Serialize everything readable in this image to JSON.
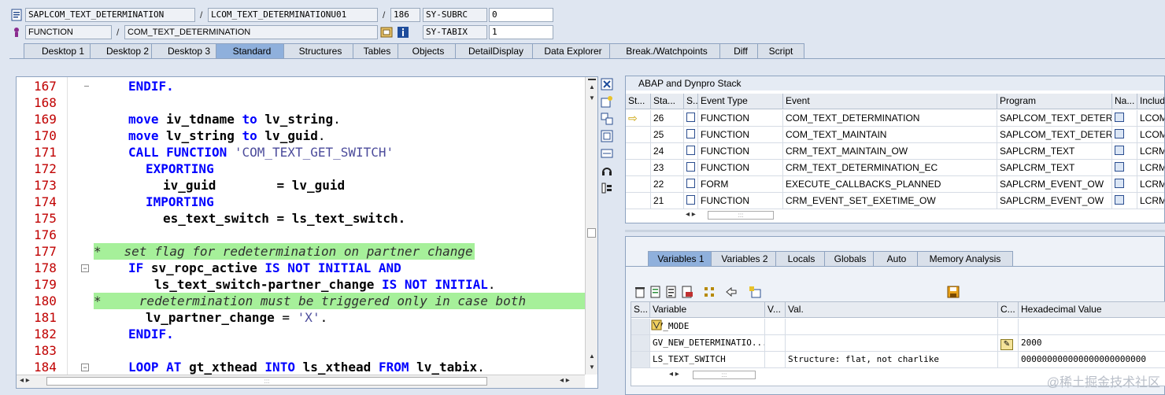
{
  "header": {
    "program": "SAPLCOM_TEXT_DETERMINATION",
    "include": "LCOM_TEXT_DETERMINATIONU01",
    "line": "186",
    "var1_name": "SY-SUBRC",
    "var1_value": "0",
    "type": "FUNCTION",
    "name": "COM_TEXT_DETERMINATION",
    "var2_name": "SY-TABIX",
    "var2_value": "1"
  },
  "tabs": [
    {
      "label": "Desktop 1"
    },
    {
      "label": "Desktop 2"
    },
    {
      "label": "Desktop 3"
    },
    {
      "label": "Standard"
    },
    {
      "label": "Structures"
    },
    {
      "label": "Tables"
    },
    {
      "label": "Objects"
    },
    {
      "label": "DetailDisplay"
    },
    {
      "label": "Data Explorer"
    },
    {
      "label": "Break./Watchpoints"
    },
    {
      "label": "Diff"
    },
    {
      "label": "Script"
    }
  ],
  "code": {
    "lines": [
      {
        "num": "167",
        "text": "ENDIF."
      },
      {
        "num": "168",
        "text": ""
      },
      {
        "num": "169",
        "text": "move iv_tdname to lv_string."
      },
      {
        "num": "170",
        "text": "move lv_string to lv_guid."
      },
      {
        "num": "171",
        "text": "CALL FUNCTION 'COM_TEXT_GET_SWITCH'"
      },
      {
        "num": "172",
        "text": "EXPORTING"
      },
      {
        "num": "173",
        "text": "iv_guid        = lv_guid"
      },
      {
        "num": "174",
        "text": "IMPORTING"
      },
      {
        "num": "175",
        "text": "es_text_switch = ls_text_switch."
      },
      {
        "num": "176",
        "text": ""
      },
      {
        "num": "177",
        "text": "*   set flag for redetermination on partner change"
      },
      {
        "num": "178",
        "text": "IF sv_ropc_active IS NOT INITIAL AND"
      },
      {
        "num": "179",
        "text": "ls_text_switch-partner_change IS NOT INITIAL."
      },
      {
        "num": "180",
        "text": "*     redetermination must be triggered only in case both"
      },
      {
        "num": "181",
        "text": "lv_partner_change = 'X'."
      },
      {
        "num": "182",
        "text": "ENDIF."
      },
      {
        "num": "183",
        "text": ""
      },
      {
        "num": "184",
        "text": "LOOP AT gt_xthead INTO ls_xthead FROM lv_tabix."
      }
    ]
  },
  "stack": {
    "title": "ABAP and Dynpro Stack",
    "columns": [
      "St...",
      "Sta...",
      "S...",
      "Event Type",
      "Event",
      "Program",
      "Na...",
      "Includ"
    ],
    "rows": [
      {
        "level": "26",
        "type": "FUNCTION",
        "event": "COM_TEXT_DETERMINATION",
        "program": "SAPLCOM_TEXT_DETER...",
        "include": "LCOM_",
        "current": true
      },
      {
        "level": "25",
        "type": "FUNCTION",
        "event": "COM_TEXT_MAINTAIN",
        "program": "SAPLCOM_TEXT_DETER...",
        "include": "LCOM_",
        "current": false
      },
      {
        "level": "24",
        "type": "FUNCTION",
        "event": "CRM_TEXT_MAINTAIN_OW",
        "program": "SAPLCRM_TEXT",
        "include": "LCRM_",
        "current": false
      },
      {
        "level": "23",
        "type": "FUNCTION",
        "event": "CRM_TEXT_DETERMINATION_EC",
        "program": "SAPLCRM_TEXT",
        "include": "LCRM_",
        "current": false
      },
      {
        "level": "22",
        "type": "FORM",
        "event": "EXECUTE_CALLBACKS_PLANNED",
        "program": "SAPLCRM_EVENT_OW",
        "include": "LCRM_",
        "current": false
      },
      {
        "level": "21",
        "type": "FUNCTION",
        "event": "CRM_EVENT_SET_EXETIME_OW",
        "program": "SAPLCRM_EVENT_OW",
        "include": "LCRM_",
        "current": false
      }
    ]
  },
  "vartabs": [
    {
      "label": "Variables 1"
    },
    {
      "label": "Variables 2"
    },
    {
      "label": "Locals"
    },
    {
      "label": "Globals"
    },
    {
      "label": "Auto"
    },
    {
      "label": "Memory Analysis"
    }
  ],
  "vars": {
    "columns": [
      "S...",
      "Variable",
      "V...",
      "Val.",
      "C...",
      "Hexadecimal Value"
    ],
    "rows": [
      {
        "name": "LV_MODE",
        "value": "",
        "hex": ""
      },
      {
        "name": "GV_NEW_DETERMINATIO...",
        "value": "",
        "hex": "2000"
      },
      {
        "name": "LS_TEXT_SWITCH",
        "value": "Structure: flat, not charlike",
        "hex": "000000000000000000000000"
      }
    ]
  },
  "watermark": "@稀土掘金技术社区",
  "colors": {
    "keyword": "#0000ff",
    "line_number": "#c00000",
    "comment_bg": "#a6f09a",
    "active_tab": "#8fb0dc"
  }
}
